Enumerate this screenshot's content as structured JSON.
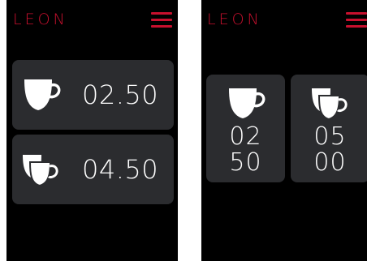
{
  "colors": {
    "brand": "#c8102e",
    "background": "#000000",
    "card": "#2b2c2f",
    "text": "#ffffff"
  },
  "screens": [
    {
      "logo": "LEON",
      "menu_icon": "hamburger-menu-icon",
      "items": [
        {
          "icon": "single-cup-icon",
          "value": "02.50"
        },
        {
          "icon": "double-cup-icon",
          "value": "04.50"
        }
      ]
    },
    {
      "logo": "LEON",
      "menu_icon": "hamburger-menu-icon",
      "items": [
        {
          "icon": "single-cup-icon",
          "value_line1": "02",
          "value_line2": "50"
        },
        {
          "icon": "double-cup-icon",
          "value_line1": "05",
          "value_line2": "00"
        }
      ]
    }
  ]
}
